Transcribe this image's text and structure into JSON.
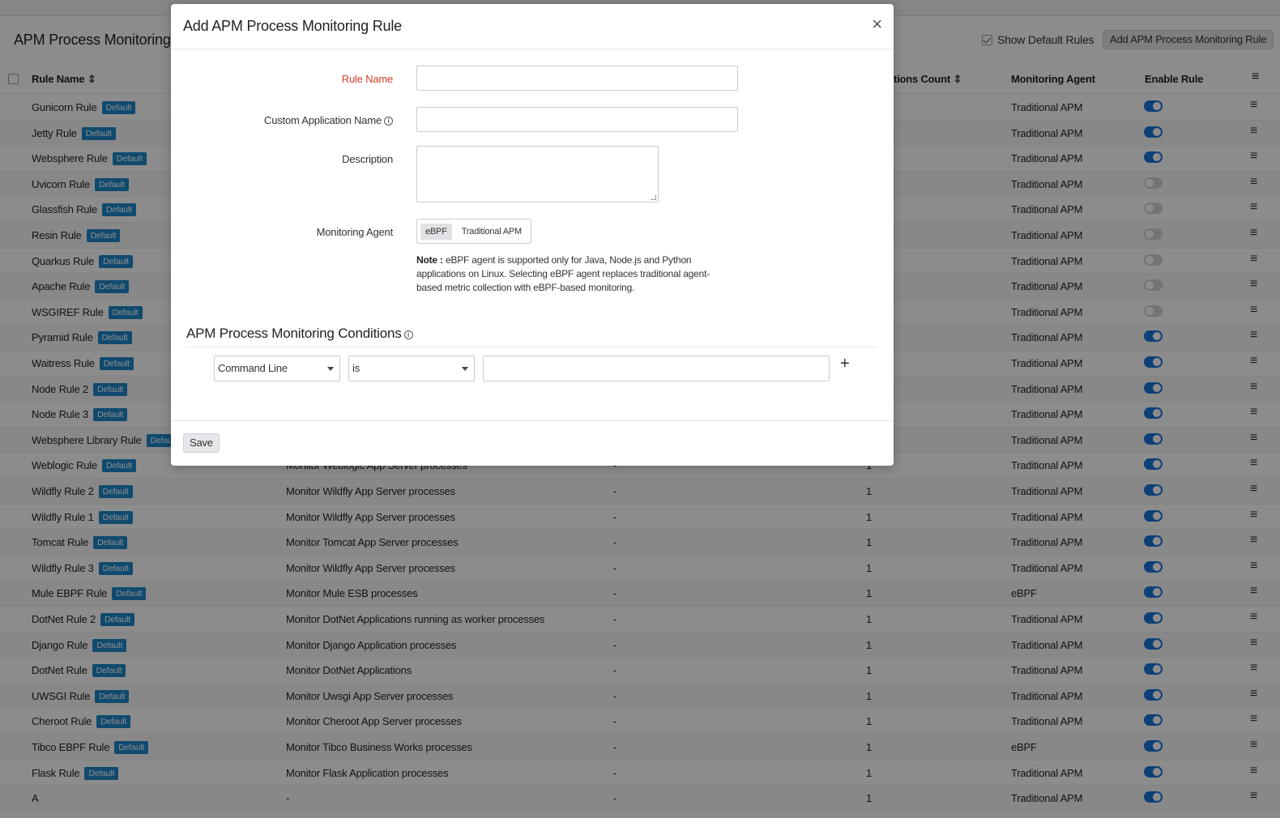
{
  "page": {
    "title": "APM Process Monitoring",
    "show_default_rules_label": "Show Default Rules",
    "add_rule_button": "Add APM Process Monitoring Rule"
  },
  "table": {
    "headers": {
      "rule_name": "Rule Name",
      "conditions_count": "tions Count",
      "monitoring_agent": "Monitoring Agent",
      "enable_rule": "Enable Rule"
    },
    "sort_glyph": "⇕",
    "default_badge": "Default",
    "rows": [
      {
        "name": "Gunicorn Rule",
        "default": true,
        "description": "",
        "app": "",
        "count": "",
        "agent": "Traditional APM",
        "enabled": true
      },
      {
        "name": "Jetty Rule",
        "default": true,
        "description": "",
        "app": "",
        "count": "",
        "agent": "Traditional APM",
        "enabled": true
      },
      {
        "name": "Websphere Rule",
        "default": true,
        "description": "",
        "app": "",
        "count": "",
        "agent": "Traditional APM",
        "enabled": true
      },
      {
        "name": "Uvicorn Rule",
        "default": true,
        "description": "",
        "app": "",
        "count": "",
        "agent": "Traditional APM",
        "enabled": false
      },
      {
        "name": "Glassfish Rule",
        "default": true,
        "description": "",
        "app": "",
        "count": "",
        "agent": "Traditional APM",
        "enabled": false
      },
      {
        "name": "Resin Rule",
        "default": true,
        "description": "",
        "app": "",
        "count": "",
        "agent": "Traditional APM",
        "enabled": false
      },
      {
        "name": "Quarkus Rule",
        "default": true,
        "description": "",
        "app": "",
        "count": "",
        "agent": "Traditional APM",
        "enabled": false
      },
      {
        "name": "Apache Rule",
        "default": true,
        "description": "",
        "app": "",
        "count": "",
        "agent": "Traditional APM",
        "enabled": false
      },
      {
        "name": "WSGIREF Rule",
        "default": true,
        "description": "",
        "app": "",
        "count": "",
        "agent": "Traditional APM",
        "enabled": false
      },
      {
        "name": "Pyramid Rule",
        "default": true,
        "description": "",
        "app": "",
        "count": "",
        "agent": "Traditional APM",
        "enabled": true
      },
      {
        "name": "Waitress Rule",
        "default": true,
        "description": "",
        "app": "",
        "count": "",
        "agent": "Traditional APM",
        "enabled": true
      },
      {
        "name": "Node Rule 2",
        "default": true,
        "description": "",
        "app": "",
        "count": "",
        "agent": "Traditional APM",
        "enabled": true
      },
      {
        "name": "Node Rule 3",
        "default": true,
        "description": "",
        "app": "",
        "count": "",
        "agent": "Traditional APM",
        "enabled": true
      },
      {
        "name": "Websphere Library Rule",
        "default": true,
        "description": "",
        "app": "",
        "count": "",
        "agent": "Traditional APM",
        "enabled": true
      },
      {
        "name": "Weblogic Rule",
        "default": true,
        "description": "Monitor Weblogic App Server processes",
        "app": "-",
        "count": "1",
        "agent": "Traditional APM",
        "enabled": true
      },
      {
        "name": "Wildfly Rule 2",
        "default": true,
        "description": "Monitor Wildfly App Server processes",
        "app": "-",
        "count": "1",
        "agent": "Traditional APM",
        "enabled": true
      },
      {
        "name": "Wildfly Rule 1",
        "default": true,
        "description": "Monitor Wildfly App Server processes",
        "app": "-",
        "count": "1",
        "agent": "Traditional APM",
        "enabled": true
      },
      {
        "name": "Tomcat Rule",
        "default": true,
        "description": "Monitor Tomcat App Server processes",
        "app": "-",
        "count": "1",
        "agent": "Traditional APM",
        "enabled": true
      },
      {
        "name": "Wildfly Rule 3",
        "default": true,
        "description": "Monitor Wildfly App Server processes",
        "app": "-",
        "count": "1",
        "agent": "Traditional APM",
        "enabled": true
      },
      {
        "name": "Mule EBPF Rule",
        "default": true,
        "description": "Monitor Mule ESB processes",
        "app": "-",
        "count": "1",
        "agent": "eBPF",
        "enabled": true
      },
      {
        "name": "DotNet Rule 2",
        "default": true,
        "description": "Monitor DotNet Applications running as worker processes",
        "app": "-",
        "count": "1",
        "agent": "Traditional APM",
        "enabled": true
      },
      {
        "name": "Django Rule",
        "default": true,
        "description": "Monitor Django Application processes",
        "app": "-",
        "count": "1",
        "agent": "Traditional APM",
        "enabled": true
      },
      {
        "name": "DotNet Rule",
        "default": true,
        "description": "Monitor DotNet Applications",
        "app": "-",
        "count": "1",
        "agent": "Traditional APM",
        "enabled": true
      },
      {
        "name": "UWSGI Rule",
        "default": true,
        "description": "Monitor Uwsgi App Server processes",
        "app": "-",
        "count": "1",
        "agent": "Traditional APM",
        "enabled": true
      },
      {
        "name": "Cheroot Rule",
        "default": true,
        "description": "Monitor Cheroot App Server processes",
        "app": "-",
        "count": "1",
        "agent": "Traditional APM",
        "enabled": true
      },
      {
        "name": "Tibco EBPF Rule",
        "default": true,
        "description": "Monitor Tibco Business Works processes",
        "app": "-",
        "count": "1",
        "agent": "eBPF",
        "enabled": true
      },
      {
        "name": "Flask Rule",
        "default": true,
        "description": "Monitor Flask Application processes",
        "app": "-",
        "count": "1",
        "agent": "Traditional APM",
        "enabled": true
      },
      {
        "name": "A",
        "default": false,
        "description": "-",
        "app": "-",
        "count": "1",
        "agent": "Traditional APM",
        "enabled": true
      }
    ]
  },
  "modal": {
    "title": "Add APM Process Monitoring Rule",
    "close_glyph": "×",
    "fields": {
      "rule_name_label": "Rule Name",
      "rule_name_value": "",
      "custom_app_label": "Custom Application Name",
      "custom_app_value": "",
      "description_label": "Description",
      "description_value": "",
      "agent_label": "Monitoring Agent",
      "agent_options": [
        "eBPF",
        "Traditional APM"
      ],
      "agent_selected": "eBPF"
    },
    "note_label": "Note :",
    "note_text": "eBPF agent is supported only for Java, Node.js and Python applications on Linux. Selecting eBPF agent replaces traditional agent-based metric collection with eBPF-based monitoring.",
    "conditions_title": "APM Process Monitoring Conditions",
    "condition": {
      "field": "Command Line",
      "operator": "is",
      "value": ""
    },
    "plus_glyph": "+",
    "info_glyph": "i",
    "save_label": "Save"
  },
  "icons": {
    "menu": "≡"
  },
  "colors": {
    "accent": "#1a73d9",
    "badge": "#1e88c9",
    "required": "#d0402b"
  }
}
